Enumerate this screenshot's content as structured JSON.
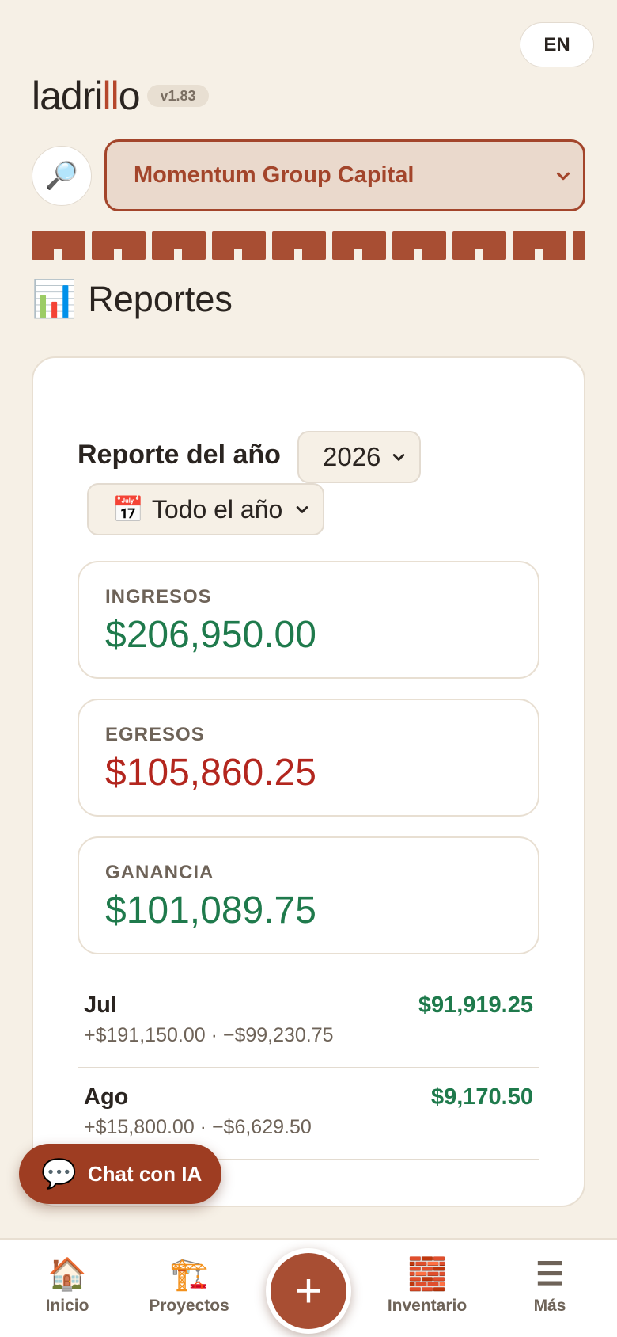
{
  "header": {
    "lang_button": "EN",
    "logo_parts": [
      "ladri",
      "ll",
      "o"
    ],
    "version": "v1.83",
    "company": "Momentum Group Capital"
  },
  "page": {
    "icon": "📊",
    "title": "Reportes"
  },
  "report": {
    "year_label": "Reporte del año",
    "year_value": "2026",
    "period_icon": "📅",
    "period_value": "Todo el año",
    "stats": [
      {
        "label": "INGRESOS",
        "value": "$206,950.00",
        "color": "#1f7a4c"
      },
      {
        "label": "EGRESOS",
        "value": "$105,860.25",
        "color": "#b3261e"
      },
      {
        "label": "GANANCIA",
        "value": "$101,089.75",
        "color": "#1f7a4c"
      }
    ],
    "months": [
      {
        "name": "Jul",
        "detail": "+$191,150.00 · −$99,230.75",
        "total": "$91,919.25"
      },
      {
        "name": "Ago",
        "detail": "+$15,800.00 · −$6,629.50",
        "total": "$9,170.50"
      }
    ]
  },
  "chat": {
    "icon": "💬",
    "label": "Chat con IA"
  },
  "nav": {
    "items": [
      {
        "icon": "🏠",
        "label": "Inicio"
      },
      {
        "icon": "🏗️",
        "label": "Proyectos"
      },
      {
        "icon": "🧱",
        "label": "Inventario"
      },
      {
        "icon": "☰",
        "label": "Más"
      }
    ],
    "fab_label": "+"
  },
  "colors": {
    "accent": "#a84e33",
    "income": "#1f7a4c",
    "expense": "#b3261e",
    "background": "#f6f0e6"
  }
}
